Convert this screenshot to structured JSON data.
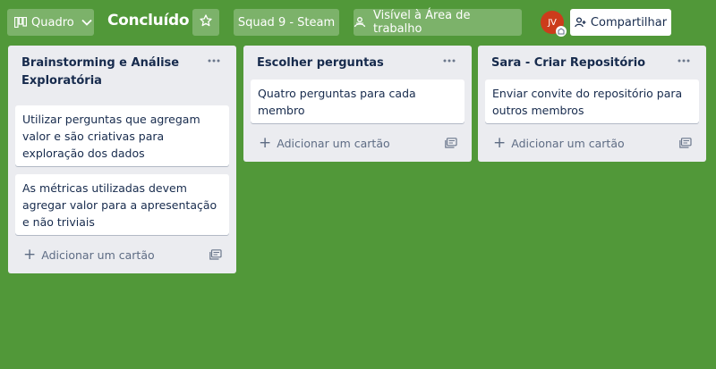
{
  "header": {
    "view_label": "Quadro",
    "board_title": "Concluído",
    "team_label": "Squad 9 - Steam",
    "visibility_label": "Visível à Área de trabalho",
    "avatar_initials": "JV",
    "share_label": "Compartilhar"
  },
  "lists": [
    {
      "title": "Brainstorming e Análise Exploratória",
      "cards": [
        "Utilizar perguntas que agregam valor e são criativas para exploração dos dados",
        "As métricas utilizadas devem agregar valor para a apresentação e não triviais"
      ],
      "add_label": "Adicionar um cartão"
    },
    {
      "title": "Escolher perguntas",
      "cards": [
        "Quatro perguntas para cada membro"
      ],
      "add_label": "Adicionar um cartão"
    },
    {
      "title": "Sara - Criar Repositório",
      "cards": [
        "Enviar convite do repositório para outros membros"
      ],
      "add_label": "Adicionar um cartão"
    }
  ],
  "colors": {
    "board_background": "#519839",
    "list_background": "#ebecf0",
    "avatar": "#cc3c1b"
  },
  "icons": {
    "view": "board-icon",
    "view_dropdown": "chevron-down-icon",
    "star": "star-icon",
    "visibility": "workspace-icon",
    "share": "add-member-icon",
    "list_menu": "ellipsis-icon",
    "add": "plus-icon",
    "template": "card-template-icon"
  }
}
